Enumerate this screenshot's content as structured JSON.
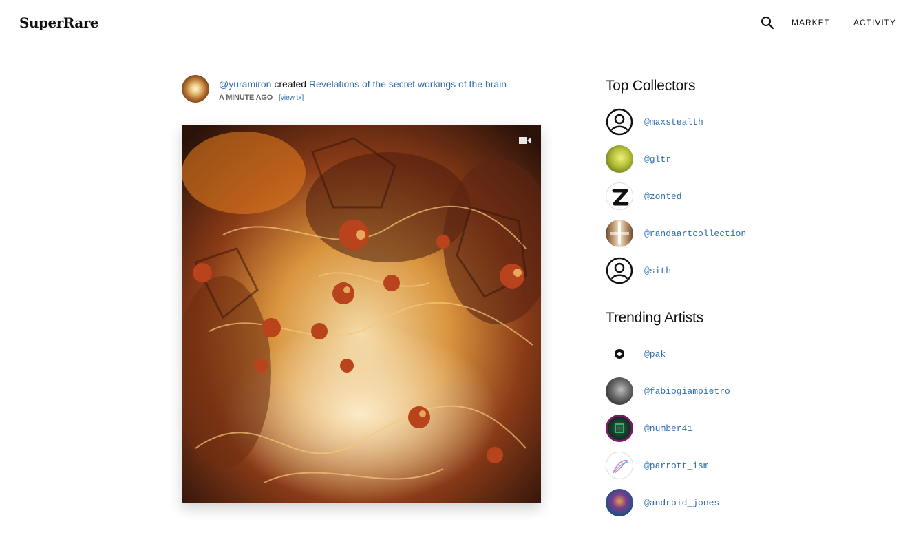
{
  "header": {
    "logo": "SuperRare",
    "nav": [
      {
        "label": "MARKET"
      },
      {
        "label": "ACTIVITY"
      }
    ]
  },
  "feed": {
    "user": "@yuramiron",
    "action": "created",
    "artwork_title": "Revelations of the secret workings of the brain",
    "time": "A MINUTE AGO",
    "tx_link": "[view tx]"
  },
  "sidebar": {
    "collectors_title": "Top Collectors",
    "collectors": [
      {
        "handle": "@maxstealth",
        "avatar": "default-user-icon"
      },
      {
        "handle": "@gltr",
        "avatar": "photo"
      },
      {
        "handle": "@zonted",
        "avatar": "z-logo"
      },
      {
        "handle": "@randaartcollection",
        "avatar": "photo"
      },
      {
        "handle": "@sith",
        "avatar": "default-user-icon"
      }
    ],
    "artists_title": "Trending Artists",
    "artists": [
      {
        "handle": "@pak",
        "avatar": "ring"
      },
      {
        "handle": "@fabiogiampietro",
        "avatar": "photo"
      },
      {
        "handle": "@number41",
        "avatar": "photo"
      },
      {
        "handle": "@parrott_ism",
        "avatar": "photo"
      },
      {
        "handle": "@android_jones",
        "avatar": "photo"
      }
    ]
  },
  "colors": {
    "link": "#2e6fb0",
    "text": "#111111"
  }
}
